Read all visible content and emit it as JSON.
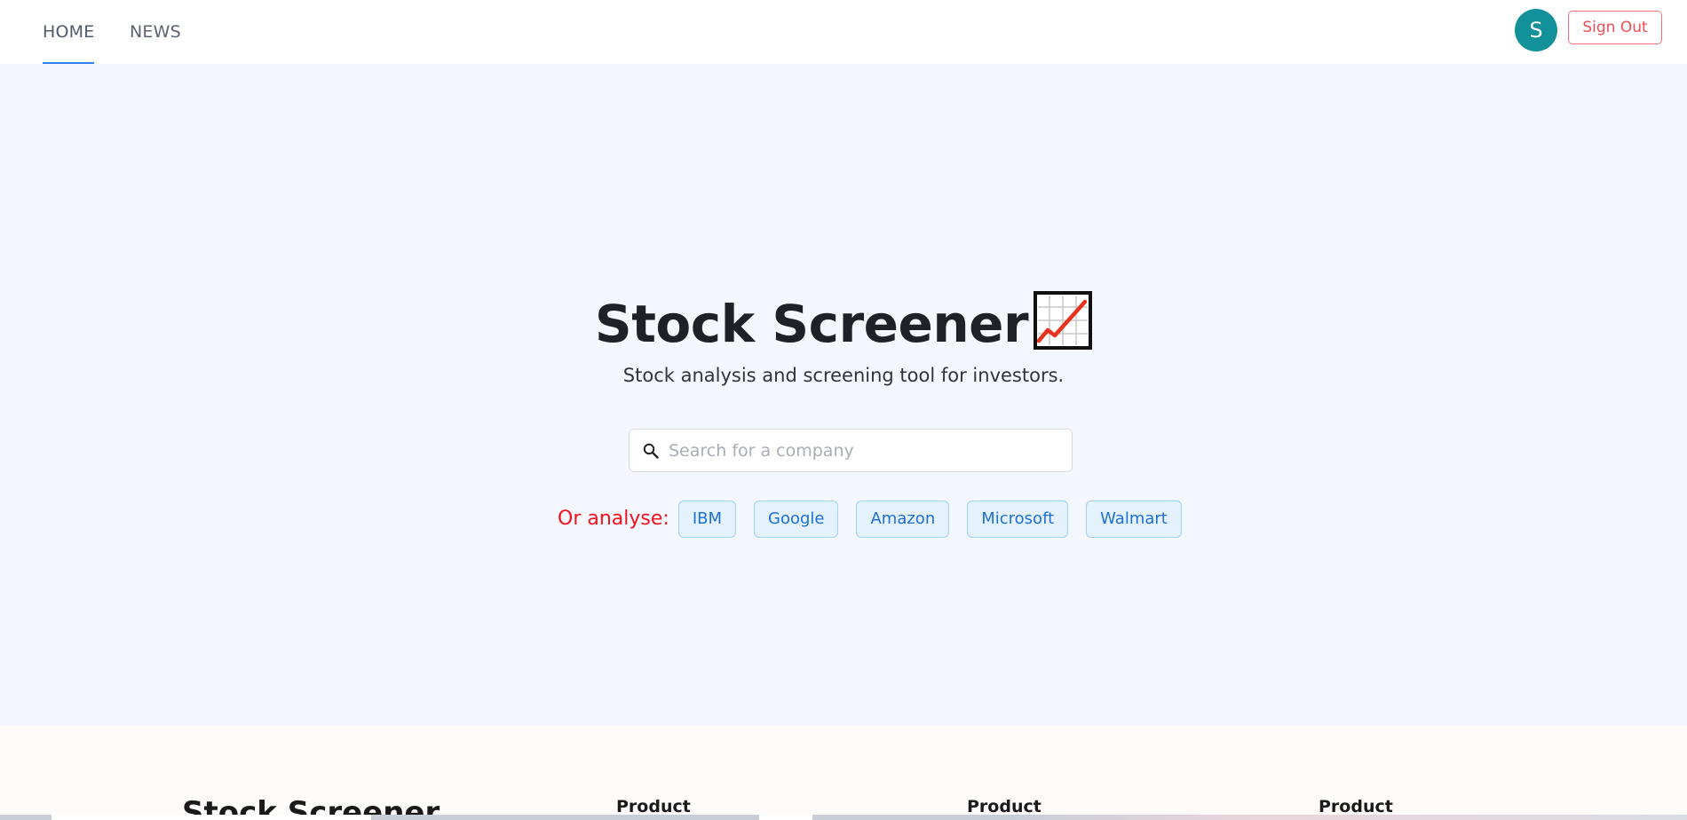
{
  "nav": {
    "tabs": [
      {
        "label": "HOME",
        "active": true
      },
      {
        "label": "NEWS",
        "active": false
      }
    ],
    "avatar_initial": "S",
    "avatar_color": "#12919a",
    "signout_label": "Sign Out"
  },
  "hero": {
    "title": "Stock Screener",
    "title_icon": "chart-increasing-icon",
    "subtitle": "Stock analysis and screening tool for investors.",
    "search_placeholder": "Search for a company",
    "search_value": "",
    "quick_label": "Or analyse:",
    "quick_links": [
      "IBM",
      "Google",
      "Amazon",
      "Microsoft",
      "Walmart"
    ]
  },
  "footer": {
    "brand": "Stock Screener",
    "columns": [
      "Product",
      "Product",
      "Product"
    ]
  },
  "colors": {
    "accent": "#2f80ed",
    "signout": "#ef4d55",
    "quick_label": "#f2121f",
    "chip_bg": "#e3f2fd",
    "chip_text": "#1f6fd6",
    "hero_bg": "#f4f7fd"
  }
}
